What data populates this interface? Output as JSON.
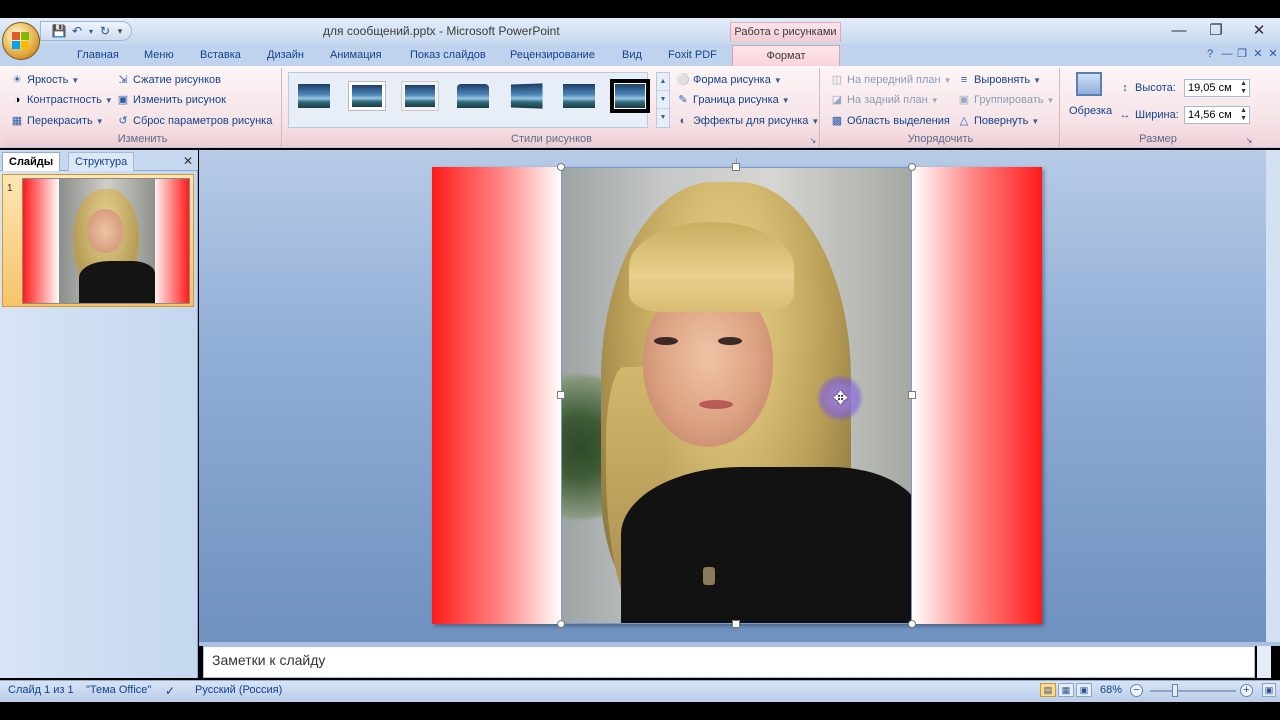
{
  "window": {
    "title": "для сообщений.pptx - Microsoft PowerPoint",
    "context_tab_group": "Работа с рисунками"
  },
  "quick_access": {
    "save_icon": "save-icon",
    "undo_icon": "undo-icon",
    "redo_icon": "redo-icon",
    "customize_icon": "dropdown-icon"
  },
  "tabs": [
    "Главная",
    "Меню",
    "Вставка",
    "Дизайн",
    "Анимация",
    "Показ слайдов",
    "Рецензирование",
    "Вид",
    "Foxit PDF"
  ],
  "active_tab": "Формат",
  "ribbon": {
    "adjust": {
      "label": "Изменить",
      "brightness": "Яркость",
      "contrast": "Контрастность",
      "recolor": "Перекрасить",
      "compress": "Сжатие рисунков",
      "change_picture": "Изменить рисунок",
      "reset_picture": "Сброс параметров рисунка"
    },
    "picture_styles": {
      "label": "Стили рисунков",
      "shape": "Форма рисунка",
      "border": "Граница рисунка",
      "effects": "Эффекты для рисунка"
    },
    "arrange": {
      "label": "Упорядочить",
      "bring_front": "На передний план",
      "send_back": "На задний план",
      "selection_pane": "Область выделения",
      "align": "Выровнять",
      "group": "Группировать",
      "rotate": "Повернуть"
    },
    "size": {
      "label": "Размер",
      "crop": "Обрезка",
      "height_label": "Высота:",
      "height_value": "19,05 см",
      "width_label": "Ширина:",
      "width_value": "14,56 см"
    }
  },
  "left_panel": {
    "tab_slides": "Слайды",
    "tab_outline": "Структура",
    "slide_number": "1"
  },
  "notes": {
    "placeholder": "Заметки к слайду"
  },
  "status": {
    "slide_info": "Слайд 1 из 1",
    "theme": "\"Тема Office\"",
    "language": "Русский (Россия)",
    "zoom": "68%"
  },
  "colors": {
    "accent": "#15428b",
    "slide_gradient": "#ff1a1a",
    "context_tab": "#f9d4da"
  }
}
